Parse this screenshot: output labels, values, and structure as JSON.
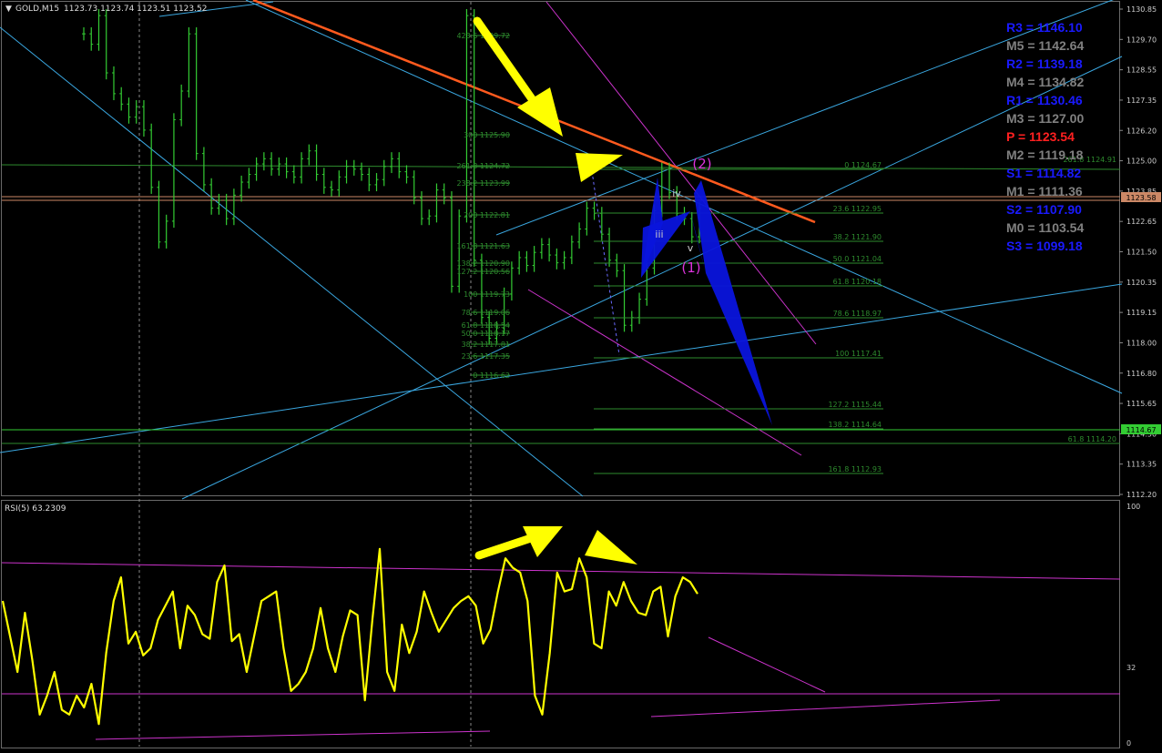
{
  "header": {
    "symbol": "GOLD,M15",
    "ohlc": "1123.73 1123.74 1123.51 1123.52",
    "rsi_label": "RSI(5) 63.2309"
  },
  "colors": {
    "background": "#000000",
    "candles": "#33cc33",
    "fib": "#2e8b2e",
    "channel": "#3aa7e0",
    "trend": "#ff5a1e",
    "magenta": "#cc33cc",
    "yellow": "#ffff00",
    "pattern": "#0a14dc"
  },
  "price_axis": {
    "ticks": [
      "1130.85",
      "1129.70",
      "1128.55",
      "1127.35",
      "1126.20",
      "1125.00",
      "1123.85",
      "1122.65",
      "1121.50",
      "1120.35",
      "1119.15",
      "1118.00",
      "1116.80",
      "1115.65",
      "1114.50",
      "1113.35",
      "1112.20"
    ],
    "current_price": "1123.58",
    "marker_price": "1114.67"
  },
  "rsi_axis": {
    "ticks": [
      "100",
      "32",
      "0"
    ]
  },
  "pivots": [
    {
      "label": "R3 = 1146.10",
      "color": "#1a1aff"
    },
    {
      "label": "M5 = 1142.64",
      "color": "#808080"
    },
    {
      "label": "R2 = 1139.18",
      "color": "#1a1aff"
    },
    {
      "label": "M4 = 1134.82",
      "color": "#808080"
    },
    {
      "label": "R1 = 1130.46",
      "color": "#1a1aff"
    },
    {
      "label": "M3 = 1127.00",
      "color": "#808080"
    },
    {
      "label": "P   = 1123.54",
      "color": "#ff2020"
    },
    {
      "label": "M2 = 1119.18",
      "color": "#808080"
    },
    {
      "label": "S1 = 1114.82",
      "color": "#1a1aff"
    },
    {
      "label": "M1 = 1111.36",
      "color": "#808080"
    },
    {
      "label": "S2 = 1107.90",
      "color": "#1a1aff"
    },
    {
      "label": "M0 = 1103.54",
      "color": "#808080"
    },
    {
      "label": "S3 = 1099.18",
      "color": "#1a1aff"
    }
  ],
  "fib_left": [
    "423.6 1129.72",
    "300 1125.90",
    "261.8 1124.72",
    "238.2 1123.99",
    "200 1122.81",
    "161.8 1121.63",
    "138.2 1120.90",
    "127.2 1120.56",
    "100 1119.73",
    "78.6 1119.06",
    "61.8 1118.54",
    "50.0 1118.17",
    "38.2 1117.81",
    "23.6 1117.35",
    "0 1116.62"
  ],
  "fib_right": [
    "0 1124.67",
    "23.6 1122.95",
    "38.2 1121.90",
    "50.0 1121.04",
    "61.8 1120.18",
    "78.6 1118.97",
    "100 1117.41",
    "127.2 1115.44",
    "138.2 1114.64",
    "161.8 1112.93"
  ],
  "fib_extra": [
    "261.8 1124.91",
    "61.8 1114.20"
  ],
  "waves": {
    "w1": "(1)",
    "w2": "(2)",
    "iii": "iii",
    "iv": "iv",
    "v": "v"
  },
  "chart_data": [
    {
      "type": "line",
      "title": "GOLD,M15",
      "ylim": [
        1112.2,
        1130.85
      ],
      "series": [
        {
          "values": [
            1129.9,
            1129.5,
            1130.6,
            1128.4,
            1127.6,
            1127.2,
            1126.7,
            1127.1,
            1126.2,
            1124.0,
            1121.9,
            1122.7,
            1126.6,
            1127.7,
            1129.9,
            1125.3,
            1124.1,
            1123.2,
            1123.5,
            1122.8,
            1123.7,
            1124.2,
            1124.5,
            1124.9,
            1125.1,
            1124.7,
            1124.9,
            1124.6,
            1124.4,
            1125.1,
            1125.4,
            1124.5,
            1124.0,
            1123.9,
            1124.4,
            1124.8,
            1124.7,
            1124.5,
            1124.1,
            1124.3,
            1124.8,
            1125.1,
            1124.6,
            1124.4,
            1123.6,
            1122.8,
            1122.9,
            1123.9,
            1123.6,
            1120.2,
            1122.9,
            1130.6,
            1121.2,
            1119.0,
            1118.2,
            1118.6,
            1119.9,
            1120.9,
            1121.3,
            1121.0,
            1121.5,
            1121.8,
            1121.4,
            1121.1,
            1121.3,
            1121.9,
            1122.4,
            1123.2,
            1123.0,
            1122.2,
            1121.2,
            1120.8,
            1118.7,
            1119.0,
            1119.7,
            1120.9,
            1123.1,
            1124.7,
            1123.8,
            1123.0,
            1122.8,
            1122.1,
            1123.2
          ]
        }
      ]
    },
    {
      "type": "line",
      "title": "RSI(5) 63.2309",
      "ylim": [
        0,
        100
      ],
      "series": [
        {
          "values": [
            60,
            45,
            30,
            55,
            35,
            12,
            20,
            30,
            14,
            12,
            20,
            15,
            25,
            8,
            38,
            60,
            70,
            42,
            47,
            37,
            40,
            52,
            58,
            64,
            40,
            58,
            54,
            46,
            44,
            68,
            75,
            43,
            46,
            30,
            45,
            60,
            62,
            64,
            40,
            22,
            25,
            30,
            40,
            57,
            40,
            30,
            45,
            56,
            54,
            18,
            52,
            82,
            30,
            22,
            50,
            38,
            47,
            64,
            55,
            47,
            52,
            57,
            60,
            62,
            58,
            42,
            48,
            64,
            78,
            74,
            72,
            60,
            20,
            12,
            38,
            72,
            64,
            65,
            78,
            70,
            42,
            40,
            64,
            58,
            68,
            60,
            55,
            54,
            64,
            66,
            45,
            62,
            70,
            68,
            63
          ]
        }
      ]
    }
  ]
}
